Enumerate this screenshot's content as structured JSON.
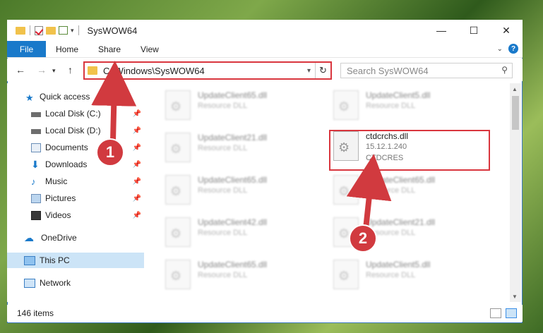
{
  "window": {
    "title": "SysWOW64"
  },
  "ribbon": {
    "tabs": [
      "File",
      "Home",
      "Share",
      "View"
    ]
  },
  "address": {
    "path": "C:\\Windows\\SysWOW64"
  },
  "search": {
    "placeholder": "Search SysWOW64"
  },
  "sidebar": {
    "items": [
      {
        "label": "Quick access",
        "icon": "star-icon"
      },
      {
        "label": "Local Disk (C:)",
        "icon": "drive-icon",
        "pinned": true
      },
      {
        "label": "Local Disk (D:)",
        "icon": "drive-icon",
        "pinned": true
      },
      {
        "label": "Documents",
        "icon": "documents-icon",
        "pinned": true
      },
      {
        "label": "Downloads",
        "icon": "downloads-icon",
        "pinned": true
      },
      {
        "label": "Music",
        "icon": "music-icon",
        "pinned": true
      },
      {
        "label": "Pictures",
        "icon": "pictures-icon",
        "pinned": true
      },
      {
        "label": "Videos",
        "icon": "videos-icon",
        "pinned": true
      },
      {
        "label": "OneDrive",
        "icon": "cloud-icon"
      },
      {
        "label": "This PC",
        "icon": "computer-icon",
        "selected": true
      },
      {
        "label": "Network",
        "icon": "network-icon"
      }
    ]
  },
  "files": [
    {
      "name": "UpdateClient65.dll",
      "desc": "Resource DLL"
    },
    {
      "name": "UpdateClient5.dll",
      "desc": "Resource DLL"
    },
    {
      "name": "UpdateClient21.dll",
      "desc": "Resource DLL"
    },
    {
      "name": "ctdcrchs.dll",
      "desc": "15.12.1.240",
      "desc2": "CTDCRES",
      "highlighted": true
    },
    {
      "name": "UpdateClient65.dll",
      "desc": "Resource DLL"
    },
    {
      "name": "UpdateClient65.dll",
      "desc": "Resource DLL"
    },
    {
      "name": "UpdateClient42.dll",
      "desc": "Resource DLL"
    },
    {
      "name": "UpdateClient21.dll",
      "desc": "Resource DLL"
    },
    {
      "name": "UpdateClient65.dll",
      "desc": "Resource DLL"
    },
    {
      "name": "UpdateClient5.dll",
      "desc": "Resource DLL"
    }
  ],
  "status": {
    "count": "146 items"
  },
  "annotations": {
    "step1": "1",
    "step2": "2",
    "color": "#d13a3f"
  }
}
